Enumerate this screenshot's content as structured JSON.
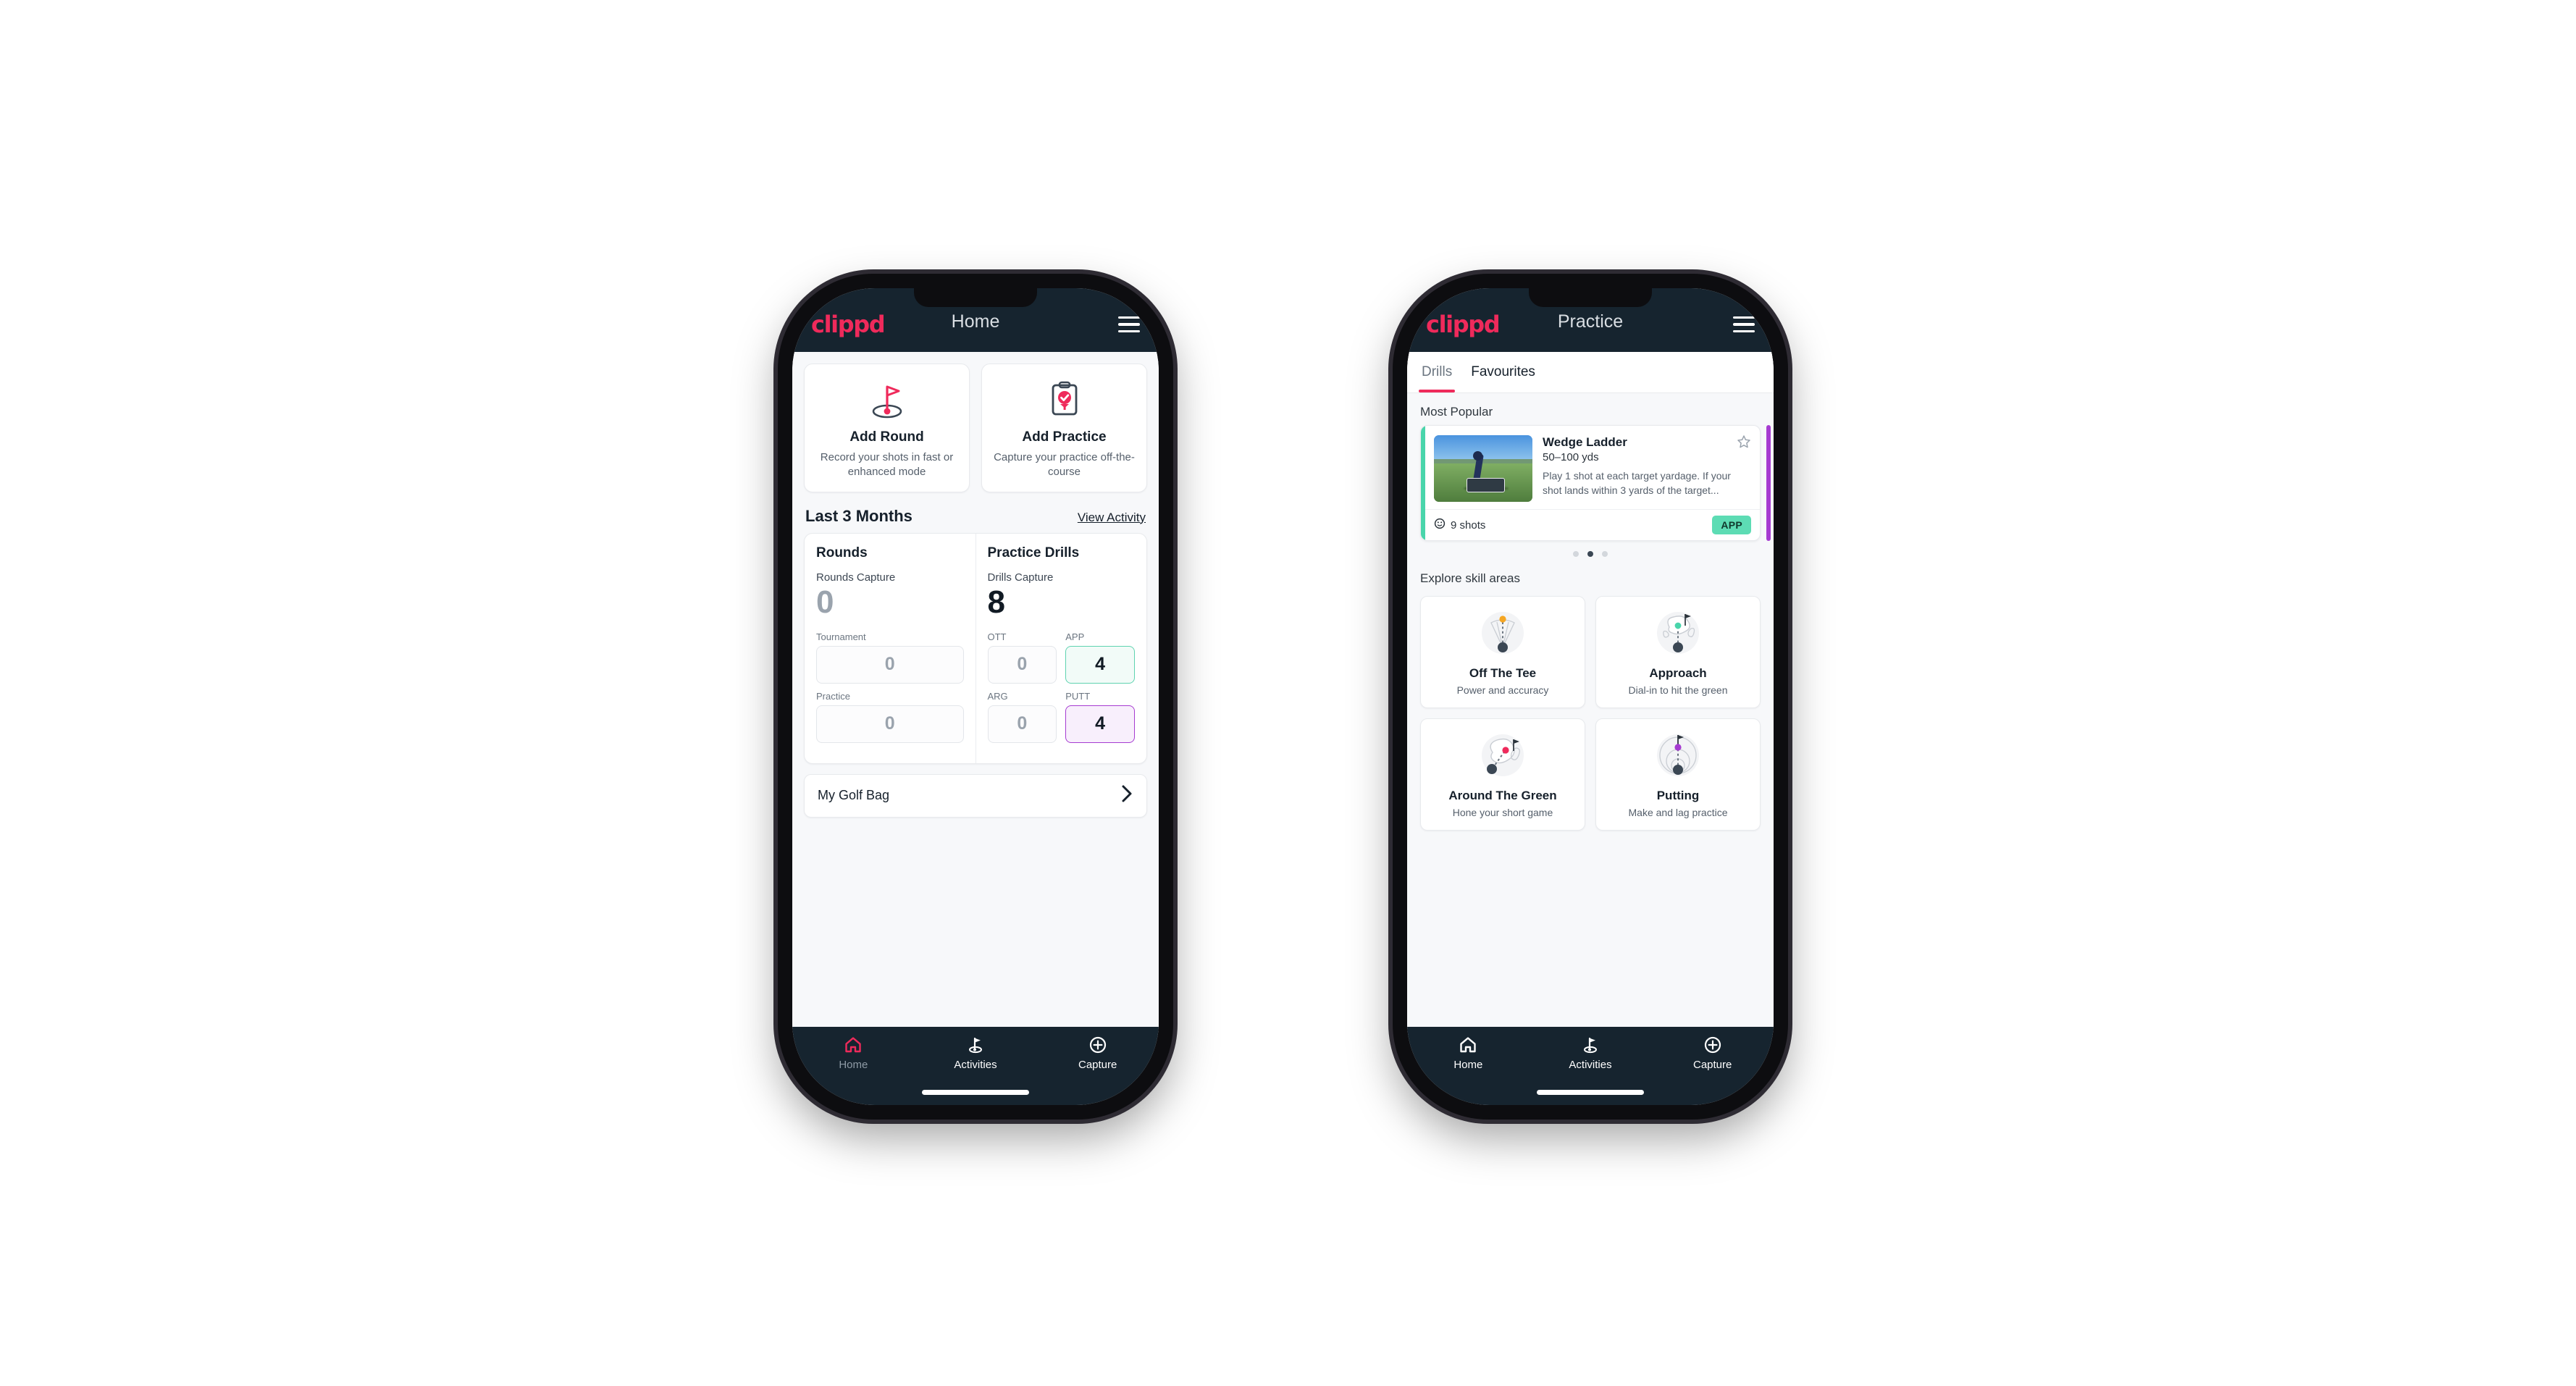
{
  "phone1": {
    "header": {
      "logo": "clippd",
      "title": "Home",
      "menu_icon": "hamburger-menu-icon"
    },
    "actions": [
      {
        "icon": "golf-flag-icon",
        "title": "Add Round",
        "subtitle": "Record your shots in fast or enhanced mode"
      },
      {
        "icon": "clipboard-check-icon",
        "title": "Add Practice",
        "subtitle": "Capture your practice off-the-course"
      }
    ],
    "section": {
      "title": "Last 3 Months",
      "link": "View Activity"
    },
    "stats": {
      "rounds": {
        "heading": "Rounds",
        "caption": "Rounds Capture",
        "value": "0",
        "fields": [
          {
            "label": "Tournament",
            "value": "0"
          },
          {
            "label": "Practice",
            "value": "0"
          }
        ]
      },
      "drills": {
        "heading": "Practice Drills",
        "caption": "Drills Capture",
        "value": "8",
        "tiles": [
          {
            "label": "OTT",
            "value": "0",
            "state": "plain"
          },
          {
            "label": "APP",
            "value": "4",
            "state": "app"
          },
          {
            "label": "ARG",
            "value": "0",
            "state": "plain"
          },
          {
            "label": "PUTT",
            "value": "4",
            "state": "putt"
          }
        ]
      }
    },
    "golf_bag": {
      "label": "My Golf Bag",
      "chevron": "chevron-right-icon"
    },
    "bottom_nav": [
      {
        "label": "Home",
        "icon": "home-icon",
        "active": true
      },
      {
        "label": "Activities",
        "icon": "golf-flag-icon",
        "active": false
      },
      {
        "label": "Capture",
        "icon": "plus-circle-icon",
        "active": false
      }
    ]
  },
  "phone2": {
    "header": {
      "logo": "clippd",
      "title": "Practice",
      "menu_icon": "hamburger-menu-icon"
    },
    "tabs": [
      {
        "label": "Drills",
        "active": true
      },
      {
        "label": "Favourites",
        "active": false
      }
    ],
    "most_popular_label": "Most Popular",
    "drill": {
      "title": "Wedge Ladder",
      "yardage": "50–100 yds",
      "description": "Play 1 shot at each target yardage. If your shot lands within 3 yards of the target...",
      "shots": "9 shots",
      "badge": "APP",
      "star_icon": "star-outline-icon",
      "clock_icon": "target-icon",
      "accent_color": "#49d5ab",
      "next_accent_color": "#a63bd1"
    },
    "carousel_dots": {
      "count": 3,
      "active_index": 1
    },
    "explore_label": "Explore skill areas",
    "skills": [
      {
        "title": "Off The Tee",
        "subtitle": "Power and accuracy",
        "icon": "tee-shot-dispersion-icon",
        "dot_color": "#f5a623"
      },
      {
        "title": "Approach",
        "subtitle": "Dial-in to hit the green",
        "icon": "approach-green-icon",
        "dot_color": "#49d5ab"
      },
      {
        "title": "Around The Green",
        "subtitle": "Hone your short game",
        "icon": "chip-green-icon",
        "dot_color": "#ef2a5b"
      },
      {
        "title": "Putting",
        "subtitle": "Make and lag practice",
        "icon": "putting-rings-icon",
        "dot_color": "#a63bd1"
      }
    ],
    "bottom_nav": [
      {
        "label": "Home",
        "icon": "home-icon",
        "active": false
      },
      {
        "label": "Activities",
        "icon": "golf-flag-icon",
        "active": false
      },
      {
        "label": "Capture",
        "icon": "plus-circle-icon",
        "active": false
      }
    ]
  },
  "colors": {
    "brand_pink": "#ef2a5b",
    "header_dark": "#16242f",
    "teal": "#49d5ab",
    "purple": "#a63bd1",
    "page_bg": "#ffffff"
  }
}
